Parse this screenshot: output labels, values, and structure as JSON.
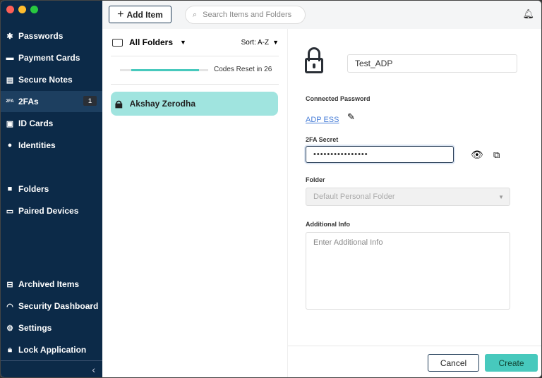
{
  "sidebar": {
    "items": [
      {
        "label": "Passwords",
        "icon": "asterisk-icon"
      },
      {
        "label": "Payment Cards",
        "icon": "card-icon"
      },
      {
        "label": "Secure Notes",
        "icon": "note-icon"
      },
      {
        "label": "2FAs",
        "icon": "2fa-icon",
        "icon_text": "2FA",
        "badge": "1",
        "active": true
      },
      {
        "label": "ID Cards",
        "icon": "id-card-icon"
      },
      {
        "label": "Identities",
        "icon": "person-icon"
      },
      {
        "label": "Folders",
        "icon": "folder-icon"
      },
      {
        "label": "Paired Devices",
        "icon": "devices-icon"
      },
      {
        "label": "Archived Items",
        "icon": "archive-icon"
      },
      {
        "label": "Security Dashboard",
        "icon": "gauge-icon"
      },
      {
        "label": "Settings",
        "icon": "gear-icon"
      },
      {
        "label": "Lock Application",
        "icon": "lock-icon"
      }
    ]
  },
  "toolbar": {
    "add_item": "Add Item",
    "search_placeholder": "Search Items and Folders"
  },
  "list": {
    "folder": "All Folders",
    "sort": "Sort: A-Z",
    "codes_reset": "Codes Reset in 26",
    "progress": 0.88,
    "items": [
      {
        "name": "Akshay Zerodha"
      }
    ]
  },
  "detail": {
    "title": "Test_ADP",
    "connected_label": "Connected Password",
    "connected_value": "ADP ESS",
    "secret_label": "2FA Secret",
    "secret_value": "••••••••••••••••",
    "folder_label": "Folder",
    "folder_value": "Default Personal Folder",
    "info_label": "Additional Info",
    "info_placeholder": "Enter Additional Info",
    "cancel": "Cancel",
    "create": "Create"
  },
  "colors": {
    "sidebar": "#0c2a48",
    "accent": "#47c9bd",
    "selected": "#a0e4df"
  }
}
